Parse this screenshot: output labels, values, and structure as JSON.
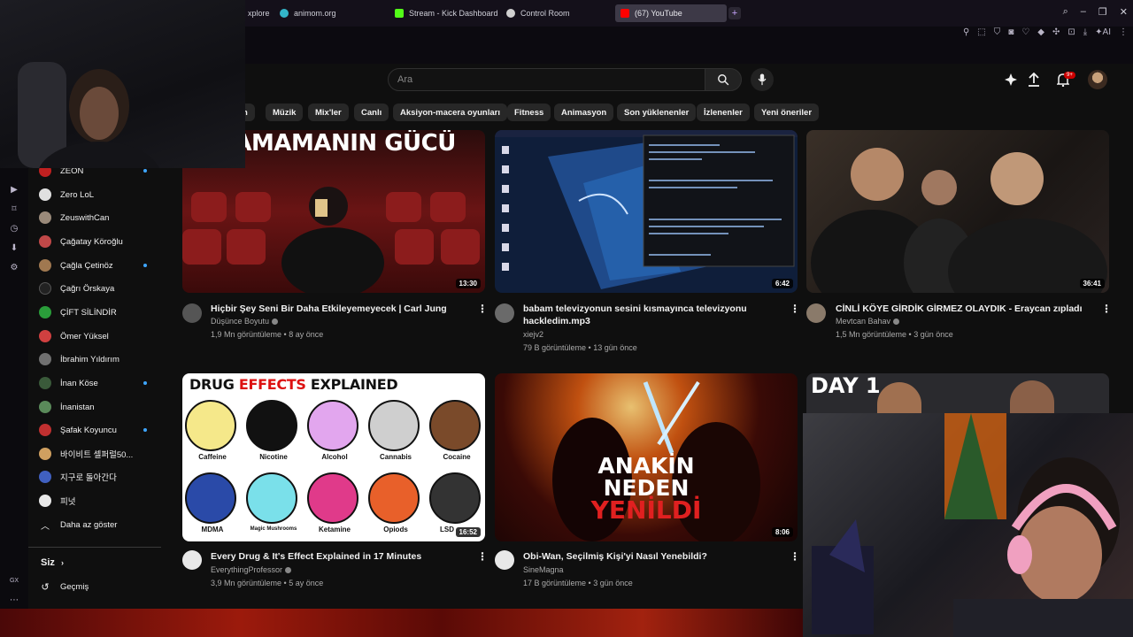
{
  "browser": {
    "tabs": [
      {
        "label": "xplore",
        "color": "#5b9bd5"
      },
      {
        "label": "animom.org",
        "color": "#33b5c9"
      },
      {
        "label": "Stream - Kick Dashboard",
        "color": "#53fc18"
      },
      {
        "label": "Control Room",
        "color": "#d0d0d0"
      },
      {
        "label": "(67) YouTube",
        "color": "#ff0000"
      }
    ],
    "add_tab": "+"
  },
  "search": {
    "placeholder": "Ara"
  },
  "notifications": {
    "badge": "9+"
  },
  "chips": [
    "n",
    "Müzik",
    "Mix'ler",
    "Canlı",
    "Aksiyon-macera oyunları",
    "Fitness",
    "Animasyon",
    "Son yüklenenler",
    "İzlenenler",
    "Yeni öneriler"
  ],
  "sidebar": {
    "subscriptions": [
      {
        "name": "ZEON",
        "live": true,
        "color": "#c02020"
      },
      {
        "name": "Zero LoL",
        "live": false,
        "color": "#e0e0e0"
      },
      {
        "name": "ZeuswithCan",
        "live": false,
        "color": "#9a8a7a"
      },
      {
        "name": "Çağatay Köroğlu",
        "live": false,
        "color": "#c04848"
      },
      {
        "name": "Çağla Çetinöz",
        "live": true,
        "color": "#a07850"
      },
      {
        "name": "Çağrı Örskaya",
        "live": false,
        "color": "#222222"
      },
      {
        "name": "ÇİFT SİLİNDİR",
        "live": false,
        "color": "#2a9d3a"
      },
      {
        "name": "Ömer Yüksel",
        "live": false,
        "color": "#d04040"
      },
      {
        "name": "İbrahim Yıldırım",
        "live": false,
        "color": "#707070"
      },
      {
        "name": "İnan Köse",
        "live": true,
        "color": "#3a5a3a"
      },
      {
        "name": "İnanistan",
        "live": false,
        "color": "#5a8a5a"
      },
      {
        "name": "Şafak Koyuncu",
        "live": true,
        "color": "#c03030"
      },
      {
        "name": "바이비트 셀퍼럴50...",
        "live": false,
        "color": "#d0a060"
      },
      {
        "name": "지구로 돌아간다",
        "live": false,
        "color": "#4060c0"
      },
      {
        "name": "피넛",
        "live": false,
        "color": "#e8e8e8"
      }
    ],
    "show_less": "Daha az göster",
    "you_section": "Siz",
    "history": "Geçmiş"
  },
  "videos": [
    {
      "title": "Hiçbir Şey Seni Bir Daha Etkileyemeyecek | Carl Jung",
      "channel": "Düşünce Boyutu",
      "meta": "1,9 Mn görüntüleme • 8 ay önce",
      "duration": "13:30",
      "overlay": "URSAMAMANIN GÜCÜ"
    },
    {
      "title_1": "babam televizyonun sesini kısmayınca televizyonu",
      "title_2": "hackledim.mp3",
      "channel": "xiejv2",
      "meta": "79 B görüntüleme • 13 gün önce",
      "duration": "6:42"
    },
    {
      "title": "CİNLİ KÖYE GİRDİK GİRMEZ OLAYDIK - Eraycan zıpladı",
      "channel": "Mevtcan Bahav",
      "meta": "1,5 Mn görüntüleme • 3 gün önce",
      "duration": "36:41"
    },
    {
      "title": "Every Drug & It's Effect Explained in 17 Minutes",
      "channel": "EverythingProfessor",
      "meta": "3,9 Mn görüntüleme • 5 ay önce",
      "duration": "16:52",
      "thumb_heading_1": "DRUG",
      "thumb_heading_2": "EFFECTS",
      "thumb_heading_3": "EXPLAINED",
      "drugs": [
        "Caffeine",
        "Nicotine",
        "Alcohol",
        "Cannabis",
        "Cocaine",
        "MDMA",
        "Magic Mushrooms",
        "Ketamine",
        "Opiods",
        "LSD"
      ]
    },
    {
      "title": "Obi-Wan, Seçilmiş Kişi'yi Nasıl Yenebildi?",
      "channel": "SineMagna",
      "meta": "17 B görüntüleme • 3 gün önce",
      "duration": "8:06",
      "overlay_1": "ANAKİN",
      "overlay_2": "NEDEN",
      "overlay_3": "YENİLDİ"
    },
    {
      "overlay": "DAY 1"
    }
  ],
  "opera": {
    "gx_label": "GX"
  }
}
